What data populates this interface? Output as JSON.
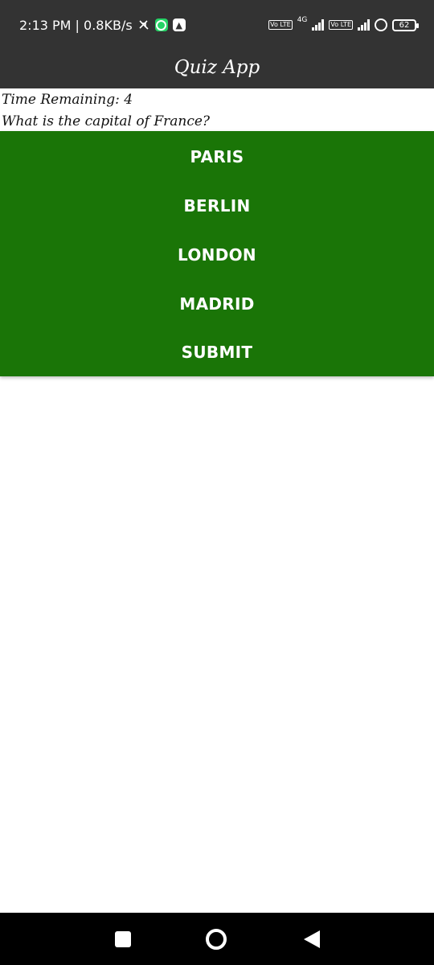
{
  "status_bar": {
    "time_speed": "2:13 PM | 0.8KB/s",
    "network_type": "4G",
    "volte_label": "Vo LTE",
    "battery": "62",
    "icons": [
      "mute-icon",
      "whatsapp-icon",
      "app-notification-icon",
      "volte-icon",
      "signal-icon",
      "hotspot-icon",
      "battery-icon"
    ]
  },
  "app_bar": {
    "title": "Quiz App"
  },
  "quiz": {
    "timer_text": "Time Remaining: 4",
    "question": "What is the capital of France?",
    "options": [
      "PARIS",
      "BERLIN",
      "LONDON",
      "MADRID"
    ],
    "submit_label": "SUBMIT"
  },
  "colors": {
    "app_bar": "#333333",
    "options_panel": "#1a7507",
    "option_text": "#ffffff",
    "nav_bar": "#000000"
  },
  "nav_bar": {
    "icons": [
      "recent-apps-icon",
      "home-icon",
      "back-icon"
    ]
  }
}
